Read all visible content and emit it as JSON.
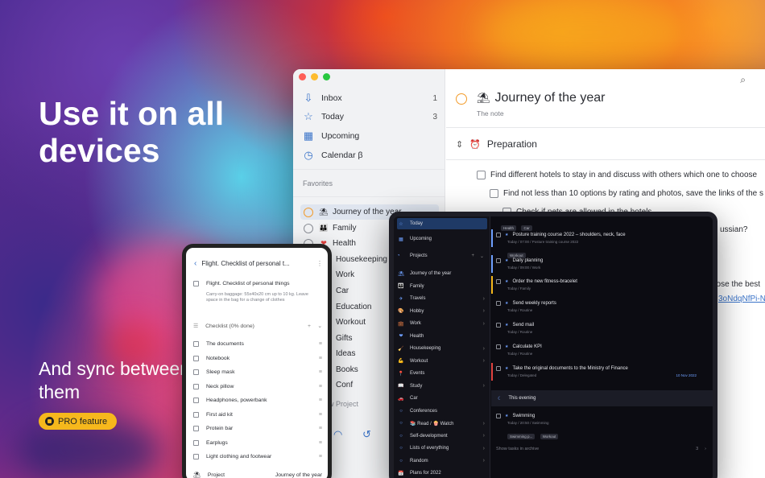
{
  "marketing": {
    "headline": "Use it on all devices",
    "subline": "And sync between them",
    "badge": "PRO feature"
  },
  "colors": {
    "accent": "#3b74c9",
    "orange": "#f29b2a",
    "badge": "#f6b81c"
  },
  "desktop": {
    "sidebar": {
      "items": [
        {
          "label": "Inbox",
          "count": "1",
          "icon": "inbox-icon"
        },
        {
          "label": "Today",
          "count": "3",
          "icon": "star-icon"
        },
        {
          "label": "Upcoming",
          "count": "",
          "icon": "calendar-icon"
        },
        {
          "label": "Calendar β",
          "count": "",
          "icon": "calendar-clock-icon"
        }
      ],
      "favorites_title": "Favorites",
      "favorites": [
        {
          "label": "Journey of the year",
          "emoji": "⛱"
        },
        {
          "label": "Family",
          "emoji": "👪"
        },
        {
          "label": "Health",
          "emoji": "❤"
        },
        {
          "label": "Housekeeping",
          "emoji": ""
        },
        {
          "label": "Work",
          "emoji": ""
        },
        {
          "label": "Car",
          "emoji": ""
        },
        {
          "label": "Education",
          "emoji": ""
        },
        {
          "label": "Workout",
          "emoji": ""
        },
        {
          "label": "Gifts",
          "emoji": ""
        },
        {
          "label": "Ideas",
          "emoji": ""
        },
        {
          "label": "Books",
          "emoji": ""
        },
        {
          "label": "Conf",
          "emoji": ""
        }
      ],
      "new_project": "w Project"
    },
    "main": {
      "title": "Journey of the year",
      "note": "The note",
      "section": "Preparation",
      "tasks": [
        "Find different hotels to stay in and discuss with others which one to choose",
        "Find not less than 10 options by rating and photos, save the links of the s",
        "Check if pets are allowed in the hotels",
        "ussian?",
        "oose the best",
        "3oNdqNfPi-Np"
      ]
    }
  },
  "tablet": {
    "sidebar": {
      "top": [
        {
          "label": "Today",
          "icon": "☆"
        },
        {
          "label": "Upcoming",
          "icon": "▦"
        }
      ],
      "projects_label": "Projects",
      "projects": [
        {
          "label": "Journey of the year",
          "emoji": "⛱",
          "arrow": ""
        },
        {
          "label": "Family",
          "emoji": "👪",
          "arrow": ""
        },
        {
          "label": "Travels",
          "emoji": "✈",
          "arrow": "›"
        },
        {
          "label": "Hobby",
          "emoji": "🎨",
          "arrow": "›"
        },
        {
          "label": "Work",
          "emoji": "💼",
          "arrow": "›"
        },
        {
          "label": "Health",
          "emoji": "❤",
          "arrow": ""
        },
        {
          "label": "Housekeeping",
          "emoji": "🧹",
          "arrow": "›"
        },
        {
          "label": "Workout",
          "emoji": "💪",
          "arrow": "›"
        },
        {
          "label": "Events",
          "emoji": "📍",
          "arrow": ""
        },
        {
          "label": "Study",
          "emoji": "📖",
          "arrow": "›"
        },
        {
          "label": "Car",
          "emoji": "🚗",
          "arrow": ""
        },
        {
          "label": "Conferences",
          "emoji": "○",
          "arrow": ""
        },
        {
          "label": "📚 Read / 🍿 Watch",
          "emoji": "○",
          "arrow": "›"
        },
        {
          "label": "Self-development",
          "emoji": "○",
          "arrow": "›"
        },
        {
          "label": "Lists of everything",
          "emoji": "○",
          "arrow": "›"
        },
        {
          "label": "Random",
          "emoji": "○",
          "arrow": "›"
        },
        {
          "label": "Plans for 2022",
          "emoji": "📅",
          "arrow": ""
        }
      ]
    },
    "tasks": [
      {
        "title": "Posture training course 2022 – shoulders, neck, face",
        "sub": "Today / 07:00 / Posture training course 2022",
        "tags": [
          "Workout"
        ],
        "bar": "#6fa0ff"
      },
      {
        "title": "Daily planning",
        "sub": "Today / 09:00 / Work",
        "tags": [],
        "bar": "#6fa0ff"
      },
      {
        "title": "Order the new fitness-bracelet",
        "sub": "Today / Family",
        "tags": [],
        "bar": "#f6b81c"
      },
      {
        "title": "Send weekly reports",
        "sub": "Today / Routine",
        "tags": [],
        "bar": ""
      },
      {
        "title": "Send mail",
        "sub": "Today / Routine",
        "tags": [],
        "bar": ""
      },
      {
        "title": "Calculate KPI",
        "sub": "Today / Routine",
        "tags": [],
        "bar": ""
      },
      {
        "title": "Take the original documents to the Ministry of Finance",
        "sub": "Today / Delegated",
        "tags": [],
        "bar": "#e2433f",
        "date": "10 Nov 2022"
      }
    ],
    "top_tags": [
      "Health",
      "Car"
    ],
    "evening": "This evening",
    "evening_task": {
      "title": "Swimming",
      "sub": "Today / 20:50 / Swimming",
      "tags": [
        "Swimming p...",
        "Workout"
      ]
    },
    "archive": "Show tasks in archive",
    "archive_count": "3"
  },
  "phone": {
    "title": "Flight. Checklist of personal t...",
    "task": "Flight. Checklist of personal things",
    "note": "Carry-on baggage: 55x40x20 cm up to 10 kg. Leave space in the bag for a change of clothes",
    "checklist": "Checklist (0% done)",
    "items": [
      "The documents",
      "Notebook",
      "Sleep mask",
      "Neck pillow",
      "Headphones, powerbank",
      "First aid kit",
      "Protein bar",
      "Earplugs",
      "Light clothing and footwear"
    ],
    "project_label": "Project",
    "project_value": "Journey of the year"
  }
}
